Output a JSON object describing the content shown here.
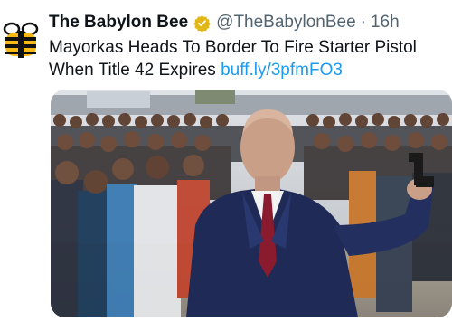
{
  "tweet": {
    "author_name": "The Babylon Bee",
    "handle": "@TheBabylonBee",
    "separator": "·",
    "time": "16h",
    "text": "Mayorkas Heads To Border To Fire Starter Pistol When Title 42 Expires",
    "link": "buff.ly/3pfmFO3",
    "verified_color": "#e2b719",
    "link_color": "#1d9bf0"
  },
  "icons": {
    "avatar": "babylon-bee-logo",
    "verified": "verified-badge-icon"
  }
}
